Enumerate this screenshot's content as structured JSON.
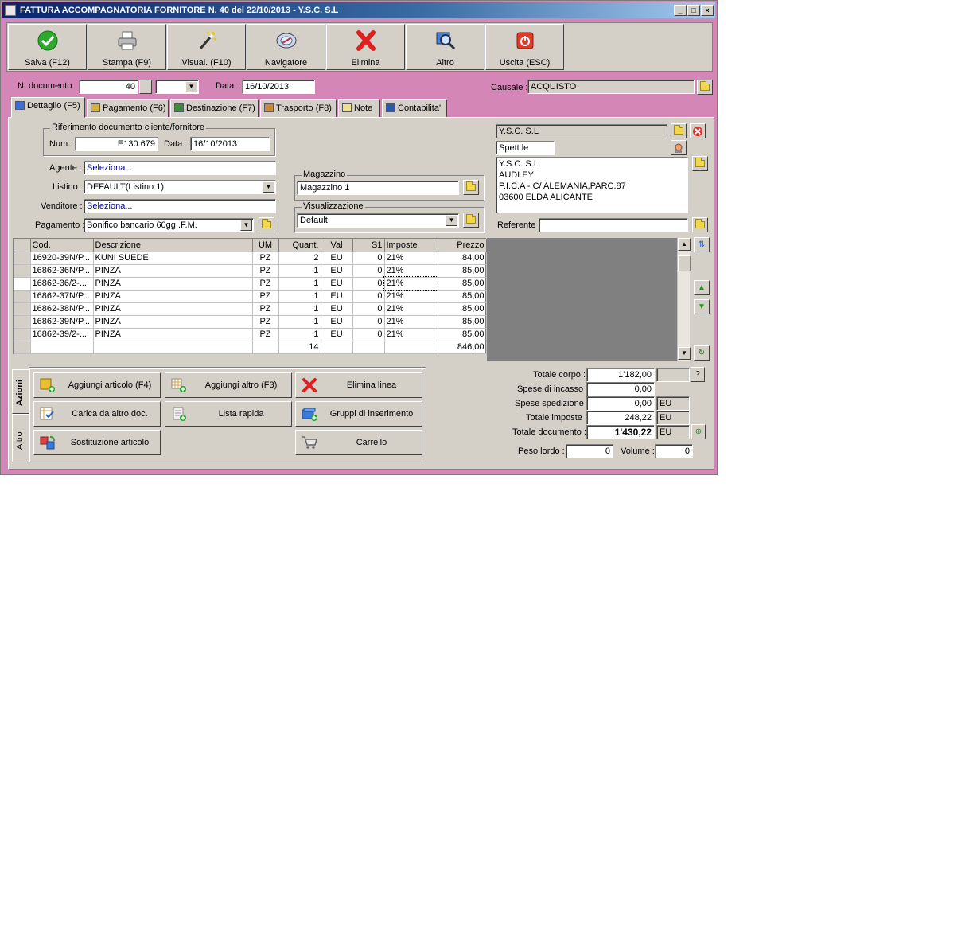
{
  "window": {
    "title": "FATTURA ACCOMPAGNATORIA FORNITORE N. 40  del 22/10/2013 - Y.S.C. S.L",
    "controls": {
      "minimize": "_",
      "maximize": "□",
      "close": "×"
    }
  },
  "toolbar": [
    {
      "label": "Salva (F12)",
      "icon": "check-icon"
    },
    {
      "label": "Stampa (F9)",
      "icon": "printer-icon"
    },
    {
      "label": "Visual. (F10)",
      "icon": "magic-wand-icon"
    },
    {
      "label": "Navigatore",
      "icon": "compass-icon"
    },
    {
      "label": "Elimina",
      "icon": "red-x-icon"
    },
    {
      "label": "Altro",
      "icon": "magnifier-icon"
    },
    {
      "label": "Uscita (ESC)",
      "icon": "power-icon"
    }
  ],
  "header": {
    "doc_number_label": "N. documento :",
    "doc_number": "40",
    "date_label": "Data :",
    "date": "16/10/2013",
    "causale_label": "Causale :",
    "causale": "ACQUISTO"
  },
  "tabs": [
    {
      "label": "Dettaglio (F5)",
      "icon": "detail-icon",
      "color": "#3b6fd6"
    },
    {
      "label": "Pagamento (F6)",
      "icon": "money-icon",
      "color": "#d8b33a"
    },
    {
      "label": "Destinazione (F7)",
      "icon": "globe-icon",
      "color": "#3a8a3a"
    },
    {
      "label": "Trasporto (F8)",
      "icon": "truck-icon",
      "color": "#c98a3a"
    },
    {
      "label": "Note",
      "icon": "note-icon",
      "color": "#f0e08a"
    },
    {
      "label": "Contabilita'",
      "icon": "book-icon",
      "color": "#2a5aa8"
    }
  ],
  "riferimento": {
    "title": "Riferimento documento cliente/fornitore",
    "num_label": "Num.:",
    "num": "E130.679",
    "date_label": "Data :",
    "date": "16/10/2013"
  },
  "form": {
    "agente_label": "Agente :",
    "agente": "Seleziona...",
    "listino_label": "Listino :",
    "listino": "DEFAULT(Listino 1)",
    "venditore_label": "Venditore :",
    "venditore": "Seleziona...",
    "pagamento_label": "Pagamento :",
    "pagamento": "Bonifico bancario 60gg .F.M."
  },
  "magazzino": {
    "title": "Magazzino",
    "value": "Magazzino 1"
  },
  "visualizzazione": {
    "title": "Visualizzazione",
    "value": "Default"
  },
  "fornitore": {
    "name": "Y.S.C. S.L",
    "title": "Spett.le",
    "address": [
      "Y.S.C. S.L",
      "AUDLEY",
      "P.I.C.A - C/ ALEMANIA,PARC.87",
      "03600 ELDA ALICANTE"
    ],
    "referente_label": "Referente"
  },
  "grid": {
    "columns": [
      "Cod.",
      "Descrizione",
      "UM",
      "Quant.",
      "Val",
      "S1",
      "Imposte",
      "Prezzo"
    ],
    "rows": [
      [
        "16920-39N/P...",
        "KUNI SUEDE",
        "PZ",
        "2",
        "EU",
        "0",
        "21%",
        "84,00"
      ],
      [
        "16862-36N/P...",
        "PINZA",
        "PZ",
        "1",
        "EU",
        "0",
        "21%",
        "85,00"
      ],
      [
        "16862-36/2-...",
        "PINZA",
        "PZ",
        "1",
        "EU",
        "0",
        "21%",
        "85,00"
      ],
      [
        "16862-37N/P...",
        "PINZA",
        "PZ",
        "1",
        "EU",
        "0",
        "21%",
        "85,00"
      ],
      [
        "16862-38N/P...",
        "PINZA",
        "PZ",
        "1",
        "EU",
        "0",
        "21%",
        "85,00"
      ],
      [
        "16862-39N/P...",
        "PINZA",
        "PZ",
        "1",
        "EU",
        "0",
        "21%",
        "85,00"
      ],
      [
        "16862-39/2-...",
        "PINZA",
        "PZ",
        "1",
        "EU",
        "0",
        "21%",
        "85,00"
      ]
    ],
    "total_quant": "14",
    "total_prezzo": "846,00"
  },
  "side_tabs": {
    "azioni": "Azioni",
    "altro": "Altro"
  },
  "actions": [
    {
      "label": "Aggiungi articolo (F4)",
      "icon": "add-box-icon"
    },
    {
      "label": "Aggiungi altro (F3)",
      "icon": "add-grid-icon"
    },
    {
      "label": "Elimina linea",
      "icon": "delete-line-icon"
    },
    {
      "label": "Carica da altro doc.",
      "icon": "load-doc-icon"
    },
    {
      "label": "Lista rapida",
      "icon": "quick-list-icon"
    },
    {
      "label": "Gruppi di inserimento",
      "icon": "insert-groups-icon"
    },
    {
      "label": "Sostituzione articolo",
      "icon": "replace-item-icon"
    },
    {
      "label": "Carrello",
      "icon": "cart-icon"
    }
  ],
  "totals": {
    "corpo_label": "Totale corpo :",
    "corpo": "1'182,00",
    "help": "?",
    "incasso_label": "Spese di incasso :",
    "incasso": "0,00",
    "spedizione_label": "Spese spedizione :",
    "spedizione": "0,00",
    "spedizione_cur": "EU",
    "imposte_label": "Totale imposte :",
    "imposte": "248,22",
    "imposte_cur": "EU",
    "documento_label": "Totale documento :",
    "documento": "1'430,22",
    "documento_cur": "EU",
    "peso_label": "Peso lordo :",
    "peso": "0",
    "volume_label": "Volume :",
    "volume": "0"
  },
  "colors": {
    "window_bg": "#d486b6",
    "face": "#d4d0c8",
    "title_start": "#0a246a",
    "title_end": "#a6caf0"
  }
}
